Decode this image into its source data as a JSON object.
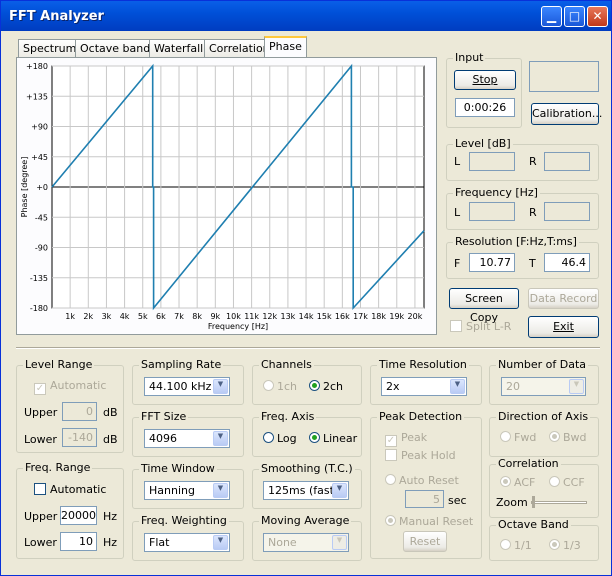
{
  "window": {
    "title": "FFT Analyzer"
  },
  "tabs": [
    "Spectrum",
    "Octave band",
    "Waterfall",
    "Correlation",
    "Phase"
  ],
  "chart_data": {
    "type": "line",
    "ylabel": "Phase [degree]",
    "xlabel": "Frequency  [Hz]",
    "y_ticks": [
      "+180",
      "+135",
      "+90",
      "+45",
      "+0",
      "-45",
      "-90",
      "-135",
      "-180"
    ],
    "x_ticks": [
      "1k",
      "2k",
      "3k",
      "4k",
      "5k",
      "6k",
      "7k",
      "8k",
      "9k",
      "10k",
      "11k",
      "12k",
      "13k",
      "14k",
      "15k",
      "16k",
      "17k",
      "18k",
      "19k",
      "20k"
    ],
    "xlim": [
      0,
      20500
    ],
    "ylim": [
      -180,
      180
    ],
    "series": [
      {
        "x": [
          0,
          5550,
          5550,
          5600,
          5600,
          16500,
          16500,
          16600,
          16600,
          20500
        ],
        "values": [
          0,
          180,
          0,
          0,
          -180,
          180,
          0,
          0,
          -180,
          -65
        ]
      }
    ]
  },
  "input": {
    "label": "Input",
    "stop": "Stop",
    "time": "0:00:26",
    "calibration": "Calibration..."
  },
  "level": {
    "label": "Level [dB]",
    "l": "L",
    "r": "R"
  },
  "frequency": {
    "label": "Frequency [Hz]",
    "l": "L",
    "r": "R"
  },
  "resolution": {
    "label": "Resolution [F:Hz,T:ms]",
    "f": "F",
    "f_val": "10.77",
    "t": "T",
    "t_val": "46.4"
  },
  "buttons": {
    "screen_copy": "Screen Copy",
    "data_record": "Data Record",
    "split": "Split L-R",
    "exit": "Exit"
  },
  "level_range": {
    "label": "Level Range",
    "automatic": "Automatic",
    "upper": "Upper",
    "upper_val": "0",
    "lower": "Lower",
    "lower_val": "-140",
    "unit": "dB"
  },
  "freq_range": {
    "label": "Freq. Range",
    "automatic": "Automatic",
    "upper": "Upper",
    "upper_val": "20000",
    "lower": "Lower",
    "lower_val": "10",
    "unit": "Hz"
  },
  "sampling": {
    "label": "Sampling Rate",
    "value": "44.100 kHz"
  },
  "fft": {
    "label": "FFT Size",
    "value": "4096"
  },
  "time_window": {
    "label": "Time Window",
    "value": "Hanning"
  },
  "freq_weight": {
    "label": "Freq. Weighting",
    "value": "Flat"
  },
  "channels": {
    "label": "Channels",
    "opt1": "1ch",
    "opt2": "2ch"
  },
  "freq_axis": {
    "label": "Freq. Axis",
    "opt1": "Log",
    "opt2": "Linear"
  },
  "smoothing": {
    "label": "Smoothing (T.C.)",
    "value": "125ms (fast)"
  },
  "moving_avg": {
    "label": "Moving Average",
    "value": "None"
  },
  "time_res": {
    "label": "Time Resolution",
    "value": "2x"
  },
  "peak": {
    "label": "Peak Detection",
    "peak": "Peak",
    "peak_hold": "Peak Hold",
    "auto_reset": "Auto Reset",
    "sec_val": "5",
    "sec": "sec",
    "manual_reset": "Manual Reset",
    "reset": "Reset"
  },
  "num_data": {
    "label": "Number of Data",
    "value": "20"
  },
  "direction": {
    "label": "Direction of Axis",
    "opt1": "Fwd",
    "opt2": "Bwd"
  },
  "correlation": {
    "label": "Correlation",
    "opt1": "ACF",
    "opt2": "CCF",
    "zoom": "Zoom"
  },
  "octave": {
    "label": "Octave Band",
    "opt1": "1/1",
    "opt2": "1/3"
  }
}
